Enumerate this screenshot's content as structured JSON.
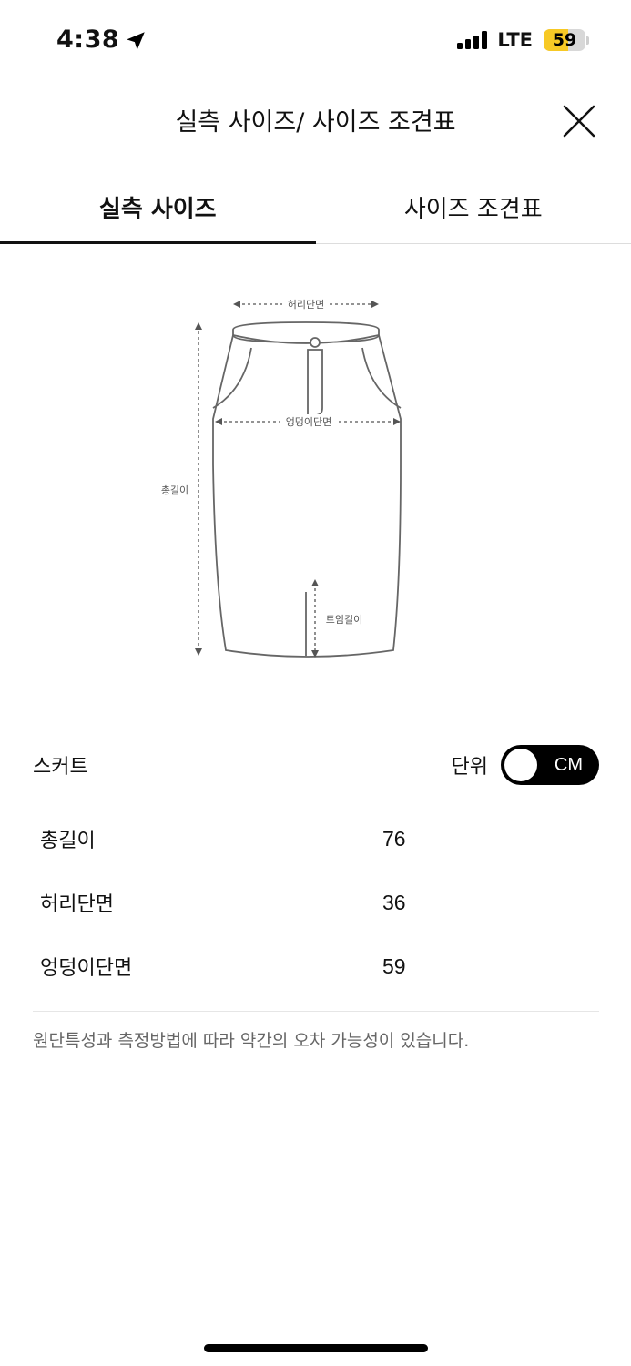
{
  "status_bar": {
    "time": "4:38",
    "network": "LTE",
    "battery": "59",
    "battery_level": 0.59,
    "battery_color": "#f7c925"
  },
  "header": {
    "title": "실측 사이즈/ 사이즈 조견표",
    "close_icon": "close-icon"
  },
  "tabs": [
    {
      "label": "실측 사이즈",
      "active": true
    },
    {
      "label": "사이즈 조견표",
      "active": false
    }
  ],
  "diagram": {
    "waist_label": "허리단면",
    "hip_label": "엉덩이단면",
    "length_label": "총길이",
    "slit_label": "트임길이"
  },
  "size_table": {
    "category": "스커트",
    "unit_label": "단위",
    "unit_value": "CM",
    "rows": [
      {
        "label": "총길이",
        "value": "76"
      },
      {
        "label": "허리단면",
        "value": "36"
      },
      {
        "label": "엉덩이단면",
        "value": "59"
      }
    ]
  },
  "note": "원단특성과 측정방법에 따라 약간의 오차 가능성이 있습니다."
}
